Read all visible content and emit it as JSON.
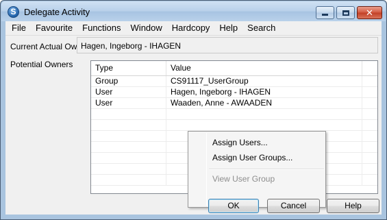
{
  "window": {
    "title": "Delegate Activity",
    "icon": "app-logo-s-icon"
  },
  "menubar": {
    "items": [
      "File",
      "Favourite",
      "Functions",
      "Window",
      "Hardcopy",
      "Help",
      "Search"
    ]
  },
  "form": {
    "current_owner_label": "Current Actual Owner",
    "current_owner_value": "Hagen, Ingeborg - IHAGEN",
    "potential_owners_label": "Potential Owners"
  },
  "grid": {
    "columns": [
      "Type",
      "Value"
    ],
    "rows": [
      {
        "type": "Group",
        "value": "CS91117_UserGroup"
      },
      {
        "type": "User",
        "value": "Hagen, Ingeborg - IHAGEN"
      },
      {
        "type": "User",
        "value": "Waaden, Anne - AWAADEN"
      }
    ]
  },
  "context_menu": {
    "items": [
      {
        "label": "Assign Users...",
        "enabled": true
      },
      {
        "label": "Assign User Groups...",
        "enabled": true
      },
      {
        "label": "View User Group",
        "enabled": false
      }
    ]
  },
  "buttons": {
    "ok": "OK",
    "cancel": "Cancel",
    "help": "Help"
  }
}
